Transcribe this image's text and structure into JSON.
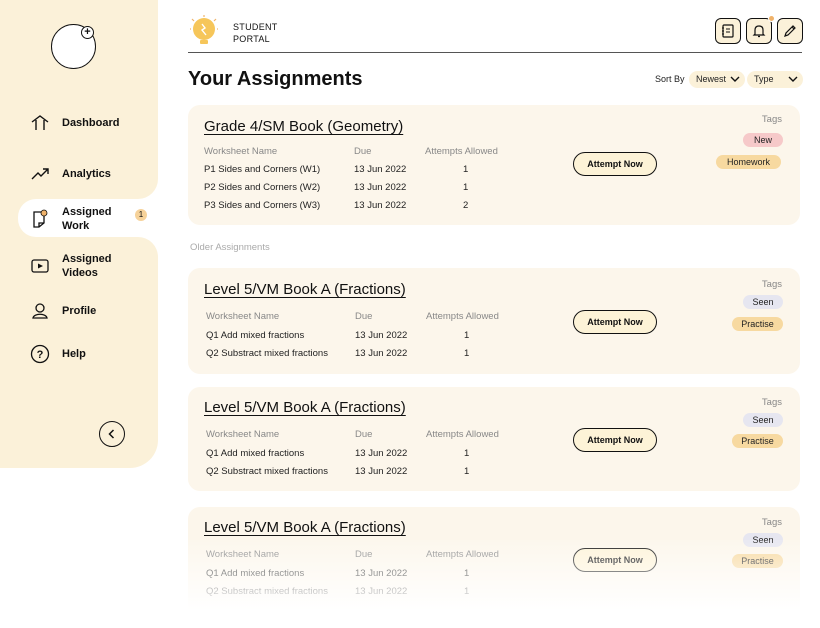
{
  "sidebar": {
    "items": [
      {
        "label": "Dashboard",
        "icon": "home-icon"
      },
      {
        "label": "Analytics",
        "icon": "trend-up-icon"
      },
      {
        "label": "Assigned Work",
        "icon": "assigned-work-icon",
        "badge": "1",
        "active": true
      },
      {
        "label": "Assigned Videos",
        "icon": "video-icon"
      },
      {
        "label": "Profile",
        "icon": "user-icon"
      },
      {
        "label": "Help",
        "icon": "help-icon"
      }
    ]
  },
  "header": {
    "brand_line1": "STUDENT",
    "brand_line2": "PORTAL"
  },
  "page": {
    "title": "Your Assignments",
    "sort_label": "Sort By",
    "sort_value": "Newest",
    "type_value": "Type",
    "older_label": "Older Assignments"
  },
  "columns": {
    "name": "Worksheet Name",
    "due": "Due",
    "attempts": "Attempts Allowed"
  },
  "attempt_label": "Attempt Now",
  "tags_label": "Tags",
  "cards": [
    {
      "title": "Grade 4/SM Book (Geometry)",
      "rows": [
        {
          "name": "P1 Sides and Corners (W1)",
          "due": "13 Jun 2022",
          "attempts": "1"
        },
        {
          "name": "P2 Sides and Corners (W2)",
          "due": "13 Jun 2022",
          "attempts": "1"
        },
        {
          "name": "P3 Sides and Corners (W3)",
          "due": "13 Jun 2022",
          "attempts": "2"
        }
      ],
      "tags": [
        "New",
        "Homework"
      ]
    },
    {
      "title": "Level 5/VM Book A (Fractions)",
      "rows": [
        {
          "name": "Q1 Add mixed fractions",
          "due": "13 Jun 2022",
          "attempts": "1"
        },
        {
          "name": "Q2 Substract mixed fractions",
          "due": "13 Jun 2022",
          "attempts": "1"
        }
      ],
      "tags": [
        "Seen",
        "Practise"
      ]
    },
    {
      "title": "Level 5/VM Book A (Fractions)",
      "rows": [
        {
          "name": "Q1 Add mixed fractions",
          "due": "13 Jun 2022",
          "attempts": "1"
        },
        {
          "name": "Q2 Substract mixed fractions",
          "due": "13 Jun 2022",
          "attempts": "1"
        }
      ],
      "tags": [
        "Seen",
        "Practise"
      ]
    },
    {
      "title": "Level 5/VM Book A (Fractions)",
      "rows": [
        {
          "name": "Q1 Add mixed fractions",
          "due": "13 Jun 2022",
          "attempts": "1"
        },
        {
          "name": "Q2 Substract mixed fractions",
          "due": "13 Jun 2022",
          "attempts": "1"
        }
      ],
      "tags": [
        "Seen",
        "Practise"
      ]
    }
  ],
  "colors": {
    "sidebar_bg": "#fbf1d9",
    "card_bg": "#fcf6eb",
    "accent": "#f7d9a0",
    "new_tag": "#f6c9c9",
    "seen_tag": "#e6e6f0"
  }
}
